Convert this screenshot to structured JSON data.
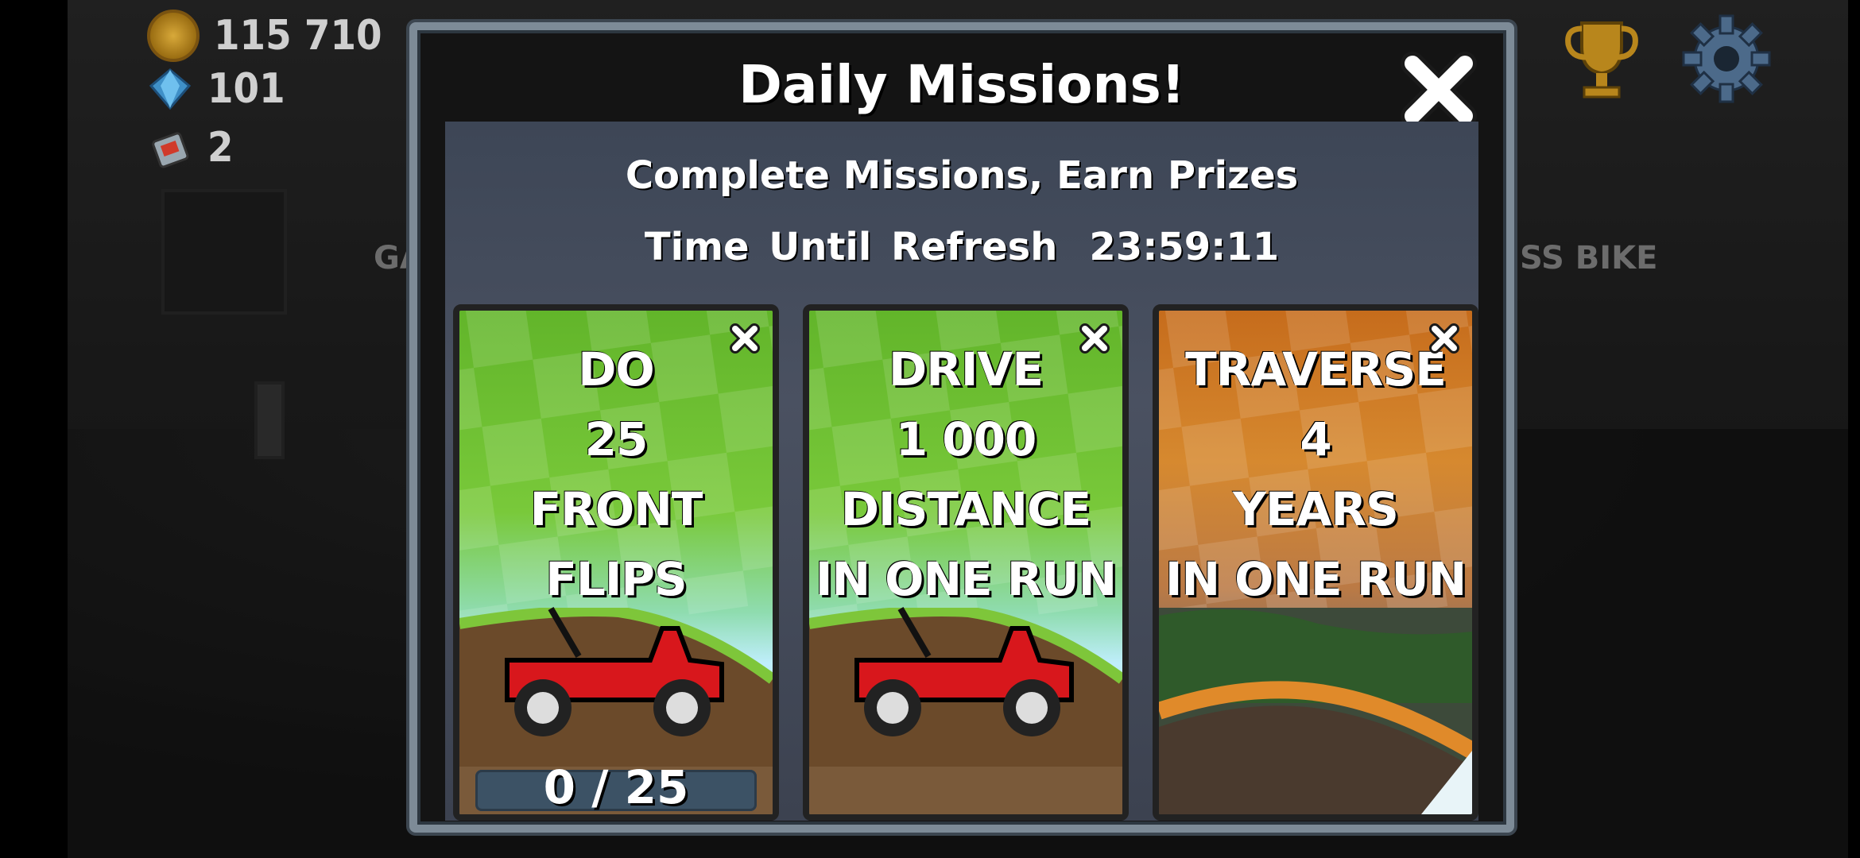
{
  "hud": {
    "coins": "115 710",
    "gems": "101",
    "fuel_cans": "2"
  },
  "background": {
    "vehicle_left_label": "GA",
    "vehicle_right_label": "SS BIKE"
  },
  "modal": {
    "title": "Daily Missions!",
    "subtitle": "Complete Missions, Earn Prizes",
    "refresh_label": "Time Until Refresh",
    "refresh_time": "23:59:11"
  },
  "missions": [
    {
      "line1": "DO",
      "line2": "25",
      "line3": "FRONT FLIPS",
      "line4": "",
      "progress": "0 / 25",
      "theme": "green"
    },
    {
      "line1": "DRIVE",
      "line2": "1 000",
      "line3": "DISTANCE",
      "line4": "IN ONE RUN",
      "progress": "",
      "theme": "green"
    },
    {
      "line1": "TRAVERSE",
      "line2": "4",
      "line3": "YEARS",
      "line4": "IN ONE RUN",
      "progress": "",
      "theme": "orange"
    }
  ],
  "colors": {
    "modal_border": "#7d8b97",
    "panel_bg": "#4a5161",
    "car_red": "#d8171c"
  },
  "icons": {
    "close": "close-icon",
    "trophy": "trophy-icon",
    "settings": "gear-icon"
  }
}
